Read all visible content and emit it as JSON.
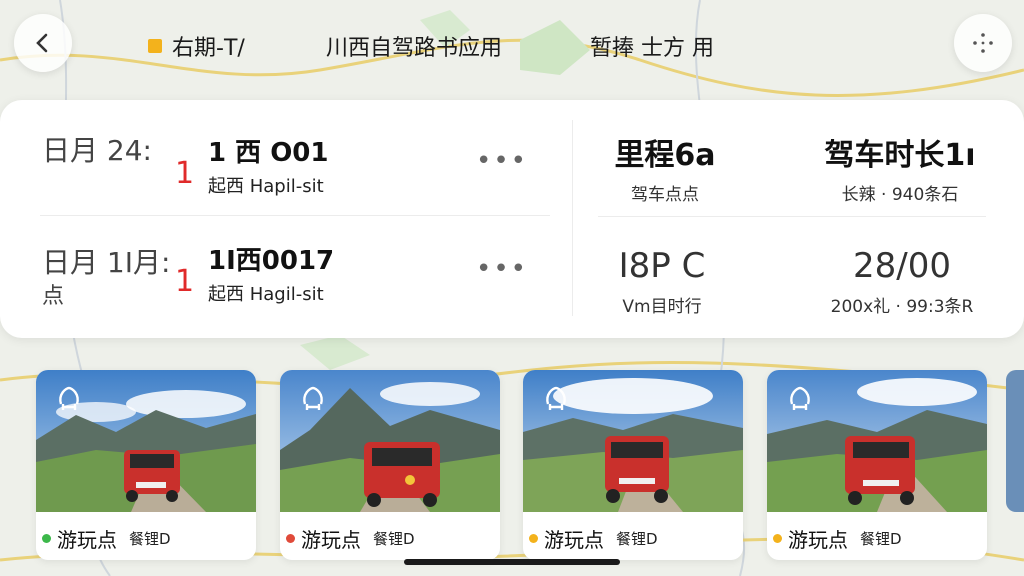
{
  "header": {
    "tabs": [
      {
        "label": "右期-T/",
        "marker_color": "#f3b21c"
      },
      {
        "label": "川西自驾路书应用"
      },
      {
        "label": "暂捧 士方 用"
      }
    ]
  },
  "trip_rows": [
    {
      "date": "日月 24:",
      "number": "1",
      "code": "1 西 O01",
      "subtitle": "起西 Hapil-sit",
      "menu": "•••"
    },
    {
      "date_line1": "日月 1I月:",
      "date_line2": "点",
      "number": "1",
      "code": "1I西0017",
      "subtitle": "起西 Hagil-sit",
      "menu": "•••"
    }
  ],
  "stats": [
    {
      "value": "里程6a",
      "label": "驾车点点"
    },
    {
      "value": "驾车时长1ı",
      "label": "长辣 · 940条石"
    },
    {
      "value": "I8P C",
      "label": "Vm目时行"
    },
    {
      "value": "28/00",
      "label": "200x礼 · 99:3条R"
    }
  ],
  "thumbnails": [
    {
      "label": "游玩点",
      "tag": "餐锂D",
      "dot_color": "#3cb84a",
      "icon": "route-icon"
    },
    {
      "label": "游玩点",
      "tag": "餐锂D",
      "dot_color": "#e04a3a",
      "icon": "refresh-route-icon"
    },
    {
      "label": "游玩点",
      "tag": "餐锂D",
      "dot_color": "#f3b21c",
      "icon": "refresh-route-icon"
    },
    {
      "label": "游玩点",
      "tag": "餐锂D",
      "dot_color": "#f3b21c",
      "icon": "refresh-route-icon"
    }
  ],
  "colors": {
    "accent_red": "#e02a2a",
    "accent_yellow": "#f3b21c"
  }
}
